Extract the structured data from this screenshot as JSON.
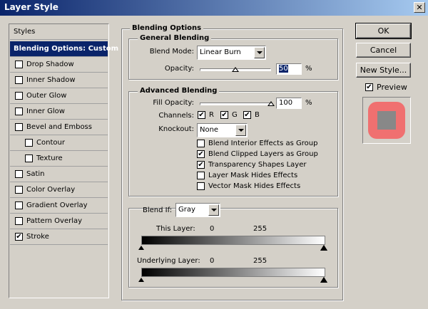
{
  "window": {
    "title": "Layer Style",
    "close_glyph": "✕"
  },
  "sidebar": {
    "header": "Styles",
    "items": [
      {
        "label": "Blending Options: Custom",
        "selected": true,
        "has_checkbox": false
      },
      {
        "label": "Drop Shadow",
        "checked": false
      },
      {
        "label": "Inner Shadow",
        "checked": false
      },
      {
        "label": "Outer Glow",
        "checked": false
      },
      {
        "label": "Inner Glow",
        "checked": false
      },
      {
        "label": "Bevel and Emboss",
        "checked": false
      },
      {
        "label": "Contour",
        "checked": false,
        "indent": true
      },
      {
        "label": "Texture",
        "checked": false,
        "indent": true
      },
      {
        "label": "Satin",
        "checked": false
      },
      {
        "label": "Color Overlay",
        "checked": false
      },
      {
        "label": "Gradient Overlay",
        "checked": false
      },
      {
        "label": "Pattern Overlay",
        "checked": false
      },
      {
        "label": "Stroke",
        "checked": true
      }
    ]
  },
  "blending_options": {
    "title": "Blending Options",
    "general": {
      "title": "General Blending",
      "blend_mode_label": "Blend Mode:",
      "blend_mode_value": "Linear Burn",
      "opacity_label": "Opacity:",
      "opacity_value": "50",
      "opacity_level": 0.5,
      "percent": "%"
    },
    "advanced": {
      "title": "Advanced Blending",
      "fill_opacity_label": "Fill Opacity:",
      "fill_opacity_value": "100",
      "fill_level": 1.0,
      "percent": "%",
      "channels_label": "Channels:",
      "channels": [
        {
          "label": "R",
          "checked": true
        },
        {
          "label": "G",
          "checked": true
        },
        {
          "label": "B",
          "checked": true
        }
      ],
      "knockout_label": "Knockout:",
      "knockout_value": "None",
      "options": [
        {
          "label": "Blend Interior Effects as Group",
          "checked": false
        },
        {
          "label": "Blend Clipped Layers as Group",
          "checked": true
        },
        {
          "label": "Transparency Shapes Layer",
          "checked": true
        },
        {
          "label": "Layer Mask Hides Effects",
          "checked": false
        },
        {
          "label": "Vector Mask Hides Effects",
          "checked": false
        }
      ]
    },
    "blend_if": {
      "label": "Blend If:",
      "value": "Gray",
      "this_layer": {
        "label": "This Layer:",
        "low": "0",
        "high": "255"
      },
      "underlying_layer": {
        "label": "Underlying Layer:",
        "low": "0",
        "high": "255"
      }
    }
  },
  "buttons": {
    "ok": "OK",
    "cancel": "Cancel",
    "new_style": "New Style...",
    "preview_label": "Preview",
    "preview_checked": true
  },
  "colors": {
    "title_start": "#0a246a",
    "title_end": "#a6caf0",
    "selection": "#0a246a",
    "preview_stroke": "#f07070",
    "preview_fill": "#888888"
  },
  "check_glyph": "✔"
}
